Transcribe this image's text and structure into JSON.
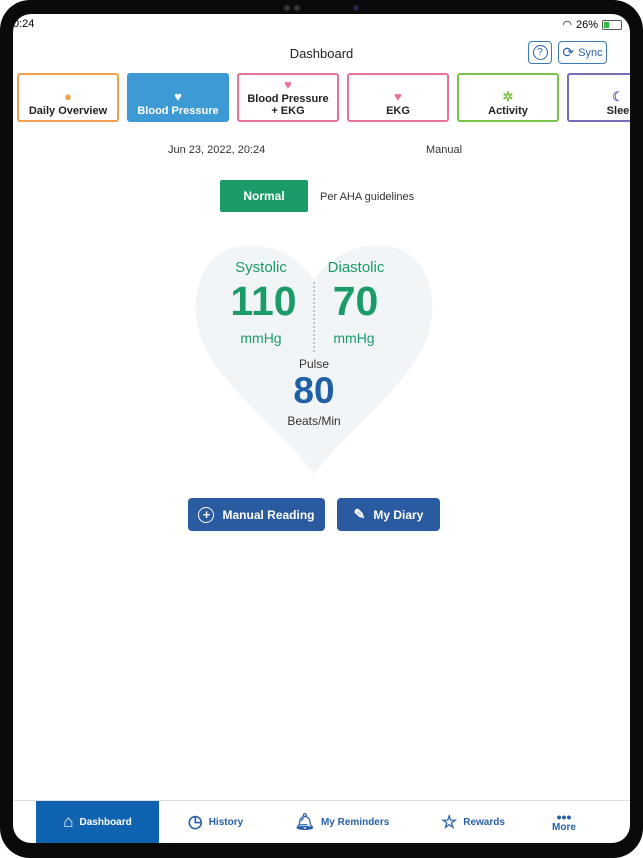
{
  "status": {
    "time": "0:24",
    "battery": "26%",
    "battery_level": 0.26
  },
  "header": {
    "title": "Dashboard",
    "help_icon": "question-circle-icon",
    "sync_label": "Sync"
  },
  "tabs": [
    {
      "label": "Daily Overview",
      "icon": "person-icon",
      "color": "#f0a050"
    },
    {
      "label": "Blood Pressure",
      "icon": "heart-icon",
      "color": "#3d9ad4",
      "active": true
    },
    {
      "label": "Blood Pressure\n+ EKG",
      "line1": "Blood Pressure",
      "line2": "+ EKG",
      "icon": "heart-ekg-icon",
      "color": "#e9709a"
    },
    {
      "label": "EKG",
      "icon": "heart-ekg-icon",
      "color": "#e9709a"
    },
    {
      "label": "Activity",
      "icon": "runner-icon",
      "color": "#7cc24a"
    },
    {
      "label": "Slee",
      "icon": "moon-icon",
      "color": "#7b6bb5"
    }
  ],
  "reading": {
    "datetime": "Jun 23, 2022, 20:24",
    "source": "Manual",
    "status": "Normal",
    "guideline": "Per AHA guidelines",
    "systolic_label": "Systolic",
    "systolic": "110",
    "diastolic_label": "Diastolic",
    "diastolic": "70",
    "unit": "mmHg",
    "pulse_label": "Pulse",
    "pulse": "80",
    "pulse_unit": "Beats/Min"
  },
  "actions": {
    "manual": "Manual Reading",
    "diary": "My Diary"
  },
  "nav": [
    {
      "label": "Dashboard",
      "active": true
    },
    {
      "label": "History"
    },
    {
      "label": "My Reminders"
    },
    {
      "label": "Rewards"
    },
    {
      "label": "More"
    }
  ],
  "colors": {
    "accent": "#2760a8",
    "green": "#1a9b68",
    "nav_active": "#0f63b0"
  }
}
